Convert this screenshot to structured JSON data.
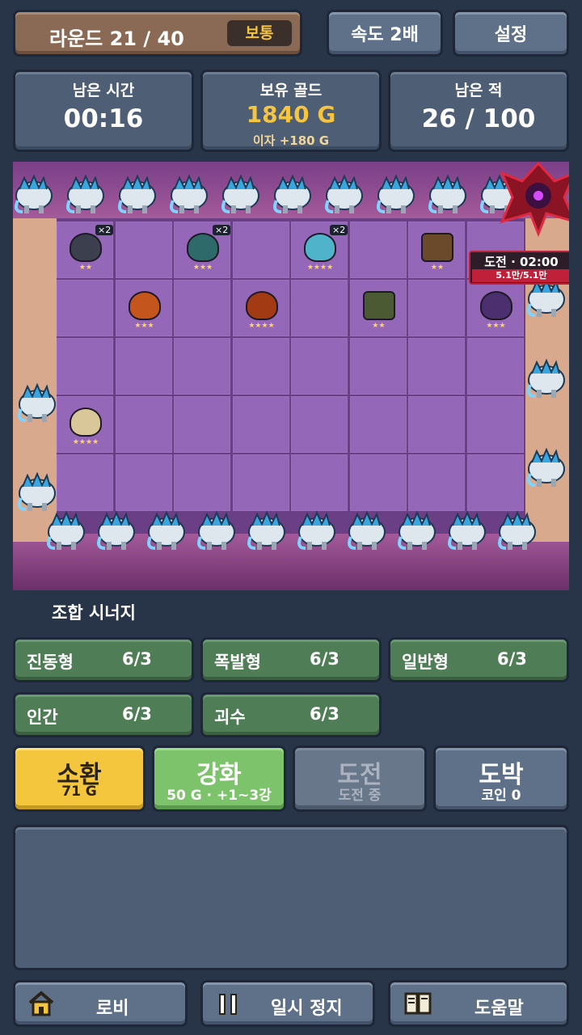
{
  "header": {
    "round_label": "라운드 21 / 40",
    "difficulty": "보통",
    "speed_button": "속도 2배",
    "settings_button": "설정"
  },
  "stats": {
    "time_label": "남은 시간",
    "time_value": "00:16",
    "gold_label": "보유 골드",
    "gold_value": "1840 G",
    "gold_interest": "이자 +180 G",
    "enemy_label": "남은 적",
    "enemy_value": "26 / 100"
  },
  "board": {
    "boss_timer": "도전 · 02:00",
    "boss_hp": "5.1만/5.1만",
    "boss_hp_fraction": 1.0,
    "units": [
      {
        "name": "creature-unit",
        "stars": "★★",
        "mult": "×2",
        "col": 0,
        "row": 0,
        "color": "#3b3f4e"
      },
      {
        "name": "creature-unit",
        "stars": "★★★",
        "mult": "×2",
        "col": 2,
        "row": 0,
        "color": "#2f6a6a"
      },
      {
        "name": "creature-unit",
        "stars": "★★★★",
        "mult": "×2",
        "col": 4,
        "row": 0,
        "color": "#4fb3c9"
      },
      {
        "name": "soldier-unit",
        "stars": "★★",
        "mult": "",
        "col": 6,
        "row": 0,
        "color": "#6b4a2b"
      },
      {
        "name": "creature-unit",
        "stars": "★★★",
        "mult": "",
        "col": 1,
        "row": 1,
        "color": "#c4561d"
      },
      {
        "name": "creature-unit",
        "stars": "★★★★",
        "mult": "",
        "col": 3,
        "row": 1,
        "color": "#a23b14"
      },
      {
        "name": "soldier-unit",
        "stars": "★★",
        "mult": "",
        "col": 5,
        "row": 1,
        "color": "#4b5a33"
      },
      {
        "name": "creature-unit",
        "stars": "★★★",
        "mult": "",
        "col": 7,
        "row": 1,
        "color": "#4c2f6e"
      },
      {
        "name": "creature-unit",
        "stars": "★★★★",
        "mult": "",
        "col": 0,
        "row": 3,
        "color": "#d9c79a"
      }
    ]
  },
  "synergy": {
    "title": "조합 시너지",
    "items": [
      {
        "name": "진동형",
        "count": "6/3"
      },
      {
        "name": "폭발형",
        "count": "6/3"
      },
      {
        "name": "일반형",
        "count": "6/3"
      },
      {
        "name": "인간",
        "count": "6/3"
      },
      {
        "name": "괴수",
        "count": "6/3"
      }
    ]
  },
  "actions": {
    "summon_label": "소환",
    "summon_cost": "71 G",
    "upgrade_label": "강화",
    "upgrade_cost": "50 G · +1~3강",
    "challenge_label": "도전",
    "challenge_status": "도전 중",
    "gamble_label": "도박",
    "gamble_coins": "코인 0"
  },
  "footer": {
    "lobby_label": "로비",
    "pause_label": "일시 정지",
    "help_label": "도움말"
  },
  "colors": {
    "background": "#283549",
    "gold": "#f5c542",
    "summon": "#f3c63d",
    "upgrade": "#7dc36b",
    "synergy": "#4f7d55",
    "boss": "#c0203a",
    "board": "#9567b9"
  }
}
